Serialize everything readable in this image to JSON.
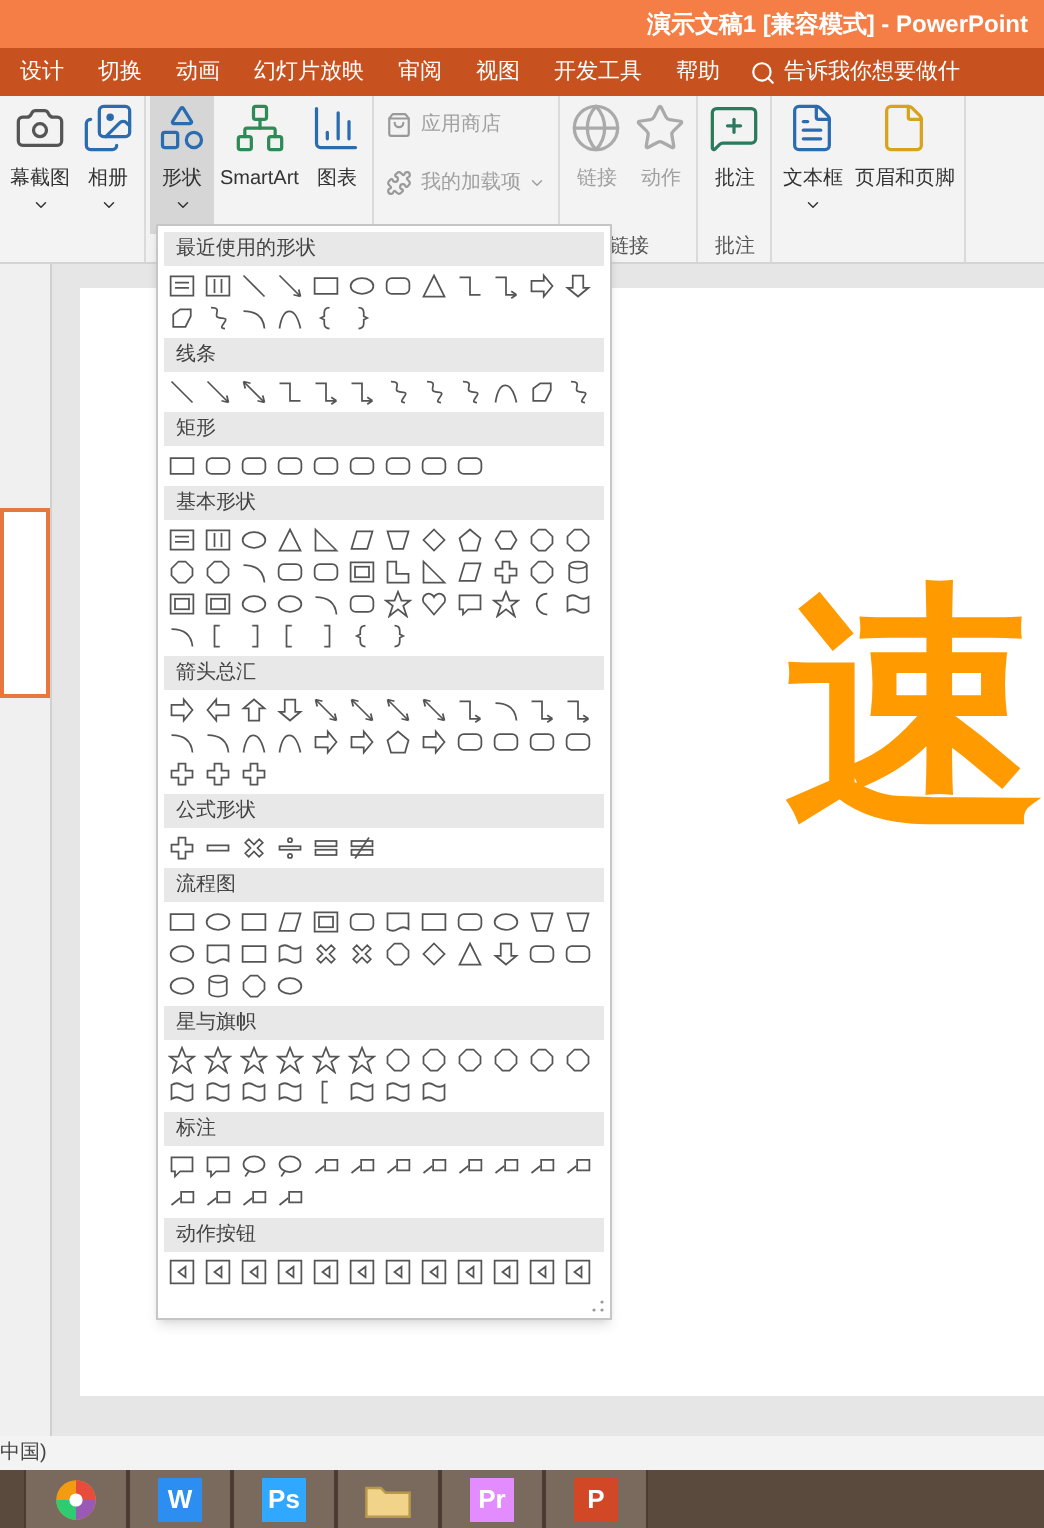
{
  "window": {
    "title": "演示文稿1 [兼容模式] - PowerPoint"
  },
  "tabs": [
    {
      "label": "设计",
      "selected": false
    },
    {
      "label": "切换",
      "selected": false
    },
    {
      "label": "动画",
      "selected": false
    },
    {
      "label": "幻灯片放映",
      "selected": false
    },
    {
      "label": "审阅",
      "selected": false
    },
    {
      "label": "视图",
      "selected": false
    },
    {
      "label": "开发工具",
      "selected": false
    },
    {
      "label": "帮助",
      "selected": false
    }
  ],
  "tell_me": {
    "placeholder": "告诉我你想要做什"
  },
  "ribbon": {
    "groups": [
      {
        "items": [
          {
            "kind": "large",
            "label": "幕截图",
            "dropdown": true,
            "selected": false,
            "disabled": false
          },
          {
            "kind": "large",
            "label": "相册",
            "dropdown": true,
            "selected": false,
            "disabled": false
          }
        ]
      },
      {
        "items": [
          {
            "kind": "large",
            "label": "形状",
            "dropdown": true,
            "selected": true,
            "disabled": false
          },
          {
            "kind": "large",
            "label": "SmartArt",
            "dropdown": false,
            "selected": false,
            "disabled": false
          },
          {
            "kind": "large",
            "label": "图表",
            "dropdown": false,
            "selected": false,
            "disabled": false
          }
        ]
      },
      {
        "items": [
          {
            "kind": "small",
            "label": "应用商店",
            "dropdown": false,
            "selected": false,
            "disabled": true
          },
          {
            "kind": "small",
            "label": "我的加载项",
            "dropdown": true,
            "selected": false,
            "disabled": true
          }
        ]
      },
      {
        "label": "链接",
        "items": [
          {
            "kind": "large",
            "label": "链接",
            "dropdown": false,
            "selected": false,
            "disabled": true
          },
          {
            "kind": "large",
            "label": "动作",
            "dropdown": false,
            "selected": false,
            "disabled": true
          }
        ]
      },
      {
        "label": "批注",
        "items": [
          {
            "kind": "large",
            "label": "批注",
            "dropdown": false,
            "selected": false,
            "disabled": false
          }
        ]
      },
      {
        "items": [
          {
            "kind": "large",
            "label": "文本框",
            "dropdown": true,
            "selected": false,
            "disabled": false
          },
          {
            "kind": "large",
            "label": "页眉和页脚",
            "dropdown": false,
            "selected": false,
            "disabled": false
          }
        ]
      }
    ]
  },
  "shapes_menu": {
    "sections": [
      {
        "title": "最近使用的形状"
      },
      {
        "title": "线条"
      },
      {
        "title": "矩形"
      },
      {
        "title": "基本形状"
      },
      {
        "title": "箭头总汇"
      },
      {
        "title": "公式形状"
      },
      {
        "title": "流程图"
      },
      {
        "title": "星与旗帜"
      },
      {
        "title": "标注"
      },
      {
        "title": "动作按钮"
      }
    ]
  },
  "thumbnail": {
    "selected": true
  },
  "slide": {
    "text": "速"
  },
  "status_bar": {
    "text": "中国)"
  },
  "taskbar": [
    {
      "kind": "wheel"
    },
    {
      "kind": "letter",
      "label": "W",
      "color": "#2b8ef0"
    },
    {
      "kind": "letter",
      "label": "Ps",
      "color": "#31a8ff"
    },
    {
      "kind": "folder"
    },
    {
      "kind": "letter",
      "label": "Pr",
      "color": "#e38cff"
    },
    {
      "kind": "letter",
      "label": "P",
      "color": "#d24726"
    }
  ]
}
